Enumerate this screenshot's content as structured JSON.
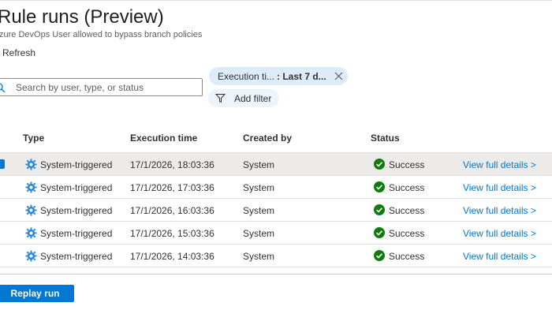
{
  "header": {
    "title": "Rule runs (Preview)",
    "subtitle": "zure DevOps User allowed to bypass branch policies",
    "refresh_label": "Refresh"
  },
  "search": {
    "placeholder": "Search by user, type, or status",
    "value": ""
  },
  "filters": {
    "chip_label": "Execution ti...",
    "chip_value": ": Last 7 d...",
    "add_filter_label": "Add filter"
  },
  "table": {
    "columns": [
      "Type",
      "Execution time",
      "Created by",
      "Status"
    ],
    "rows": [
      {
        "type": "System-triggered",
        "execution_time": "17/1/2026, 18:03:36",
        "created_by": "System",
        "status": "Success",
        "link": "View full details >"
      },
      {
        "type": "System-triggered",
        "execution_time": "17/1/2026, 17:03:36",
        "created_by": "System",
        "status": "Success",
        "link": "View full details >"
      },
      {
        "type": "System-triggered",
        "execution_time": "17/1/2026, 16:03:36",
        "created_by": "System",
        "status": "Success",
        "link": "View full details >"
      },
      {
        "type": "System-triggered",
        "execution_time": "17/1/2026, 15:03:36",
        "created_by": "System",
        "status": "Success",
        "link": "View full details >"
      },
      {
        "type": "System-triggered",
        "execution_time": "17/1/2026, 14:03:36",
        "created_by": "System",
        "status": "Success",
        "link": "View full details >"
      }
    ]
  },
  "footer": {
    "replay_label": "Replay run"
  },
  "colors": {
    "accent": "#0078d4",
    "success": "#107c10",
    "selected_row": "#edebe9",
    "chip_bg": "#deecf9"
  },
  "icons": [
    "search-icon",
    "close-icon",
    "filter-icon",
    "gear-icon",
    "check-circle-icon"
  ]
}
